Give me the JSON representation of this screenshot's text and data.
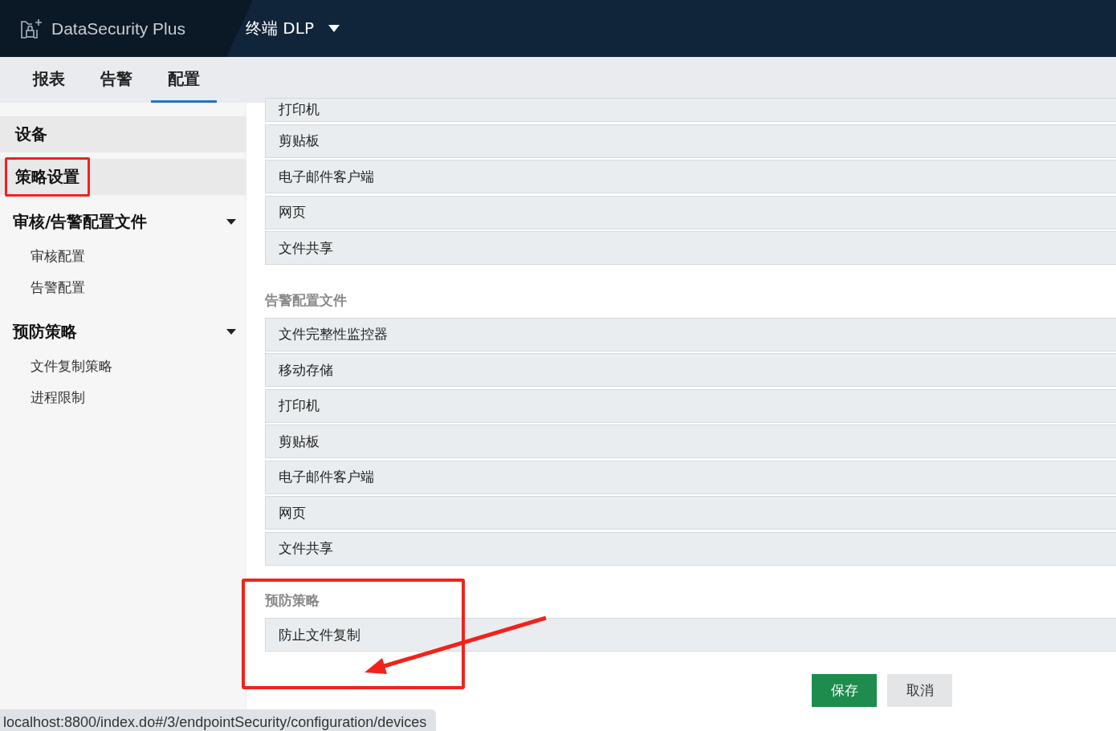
{
  "header": {
    "product": "DataSecurity Plus",
    "module": "终端 DLP"
  },
  "tabs": [
    {
      "label": "报表",
      "selected": false
    },
    {
      "label": "告警",
      "selected": false
    },
    {
      "label": "配置",
      "selected": true
    }
  ],
  "sidebar": {
    "items": [
      {
        "label": "设备",
        "kind": "item",
        "highlighted": false
      },
      {
        "label": "策略设置",
        "kind": "item",
        "highlighted": true
      },
      {
        "label": "审核/告警配置文件",
        "kind": "group",
        "expanded": true,
        "children": [
          {
            "label": "审核配置"
          },
          {
            "label": "告警配置"
          }
        ]
      },
      {
        "label": "预防策略",
        "kind": "group",
        "expanded": true,
        "children": [
          {
            "label": "文件复制策略"
          },
          {
            "label": "进程限制"
          }
        ]
      }
    ]
  },
  "sections": [
    {
      "items": [
        "打印机",
        "剪贴板",
        "电子邮件客户端",
        "网页",
        "文件共享"
      ],
      "highlighted": false
    },
    {
      "title": "告警配置文件",
      "items": [
        "文件完整性监控器",
        "移动存储",
        "打印机",
        "剪贴板",
        "电子邮件客户端",
        "网页",
        "文件共享"
      ],
      "highlighted": false
    },
    {
      "title": "预防策略",
      "items": [
        "防止文件复制"
      ],
      "highlighted": true
    }
  ],
  "buttons": [
    {
      "label": "保存",
      "kind": "primary"
    },
    {
      "label": "取消",
      "kind": "secondary"
    }
  ],
  "status_bar": {
    "url": "localhost:8800/index.do#/3/endpointSecurity/configuration/devices"
  }
}
